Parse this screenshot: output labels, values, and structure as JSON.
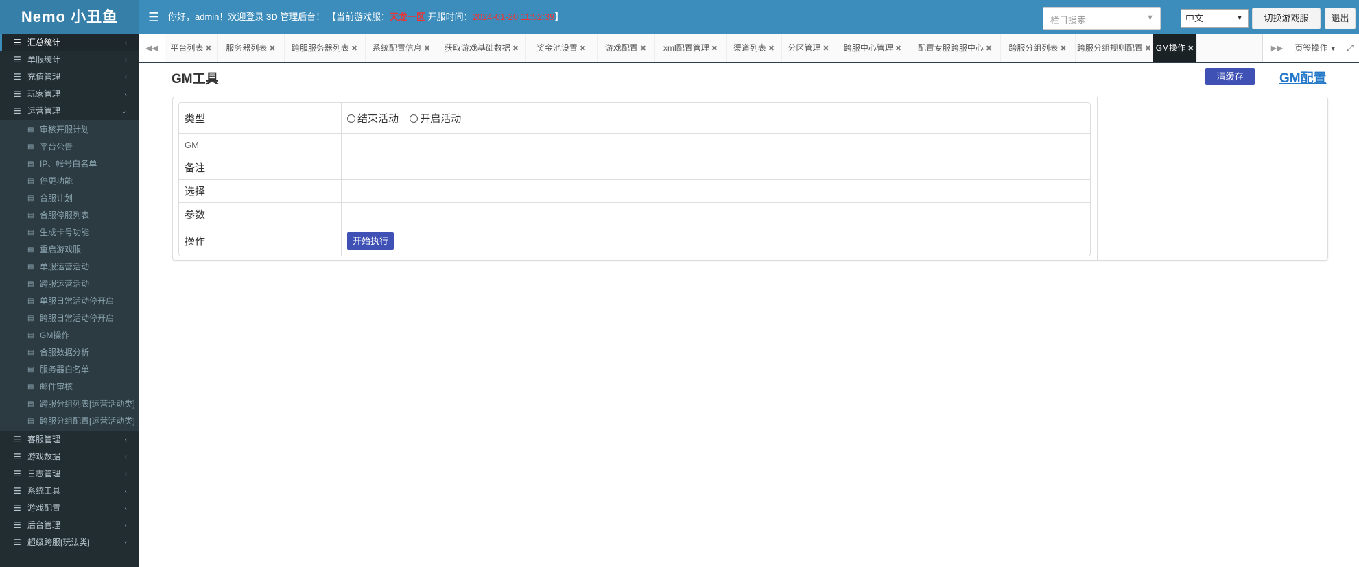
{
  "header": {
    "logo": "Nemo 小丑鱼",
    "menu_icon": "bars-icon",
    "welcome_prefix": "你好，admin！欢迎登录",
    "welcome_brand": "3D",
    "welcome_suffix": "管理后台！",
    "current_server_label": "【当前游戏服：",
    "current_server_value": "天龙一区",
    "open_time_label": "开服时间：",
    "open_time_value": "2024-01-20 11:52:39",
    "close_bracket": "】",
    "search_placeholder": "栏目搜索",
    "language": "中文",
    "switch_server": "切换游戏服",
    "logout": "退出"
  },
  "sidebar": {
    "top_groups": [
      {
        "label": "汇总统计",
        "active": true
      },
      {
        "label": "单服统计"
      },
      {
        "label": "充值管理"
      },
      {
        "label": "玩家管理"
      },
      {
        "label": "运营管理",
        "expanded": true
      }
    ],
    "sub_items": [
      "审核开服计划",
      "平台公告",
      "IP、帐号白名单",
      "停更功能",
      "合服计划",
      "合服停服列表",
      "生成卡号功能",
      "重启游戏服",
      "单服运营活动",
      "跨服运营活动",
      "单服日常活动停开启",
      "跨服日常活动停开启",
      "GM操作",
      "合服数据分析",
      "服务器白名单",
      "邮件审核",
      "跨服分组列表[运营活动类]",
      "跨服分组配置[运营活动类]"
    ],
    "bottom_groups": [
      "客服管理",
      "游戏数据",
      "日志管理",
      "系统工具",
      "游戏配置",
      "后台管理",
      "超级跨服[玩法类]"
    ]
  },
  "tabs": {
    "items": [
      "平台列表",
      "服务器列表",
      "跨服服务器列表",
      "系统配置信息",
      "获取游戏基础数据",
      "奖金池设置",
      "游戏配置",
      "xml配置管理",
      "渠道列表",
      "分区管理",
      "跨服中心管理",
      "配置专服跨服中心",
      "跨服分组列表",
      "跨服分组规则配置",
      "GM操作"
    ],
    "active_index": 14,
    "page_ops": "页签操作"
  },
  "main": {
    "title": "GM工具",
    "clear_cache": "清缓存",
    "gm_config": "GM配置",
    "form": {
      "type_label": "类型",
      "type_options": [
        "结束活动",
        "开启活动"
      ],
      "gm_label": "GM",
      "remark_label": "备注",
      "select_label": "选择",
      "params_label": "参数",
      "action_label": "操作",
      "execute_button": "开始执行"
    }
  },
  "colors": {
    "header": "#3c8dbc",
    "logo_bg": "#367fa9",
    "sidebar": "#222d32",
    "button": "#3f51b5",
    "highlight": "#e33333"
  }
}
